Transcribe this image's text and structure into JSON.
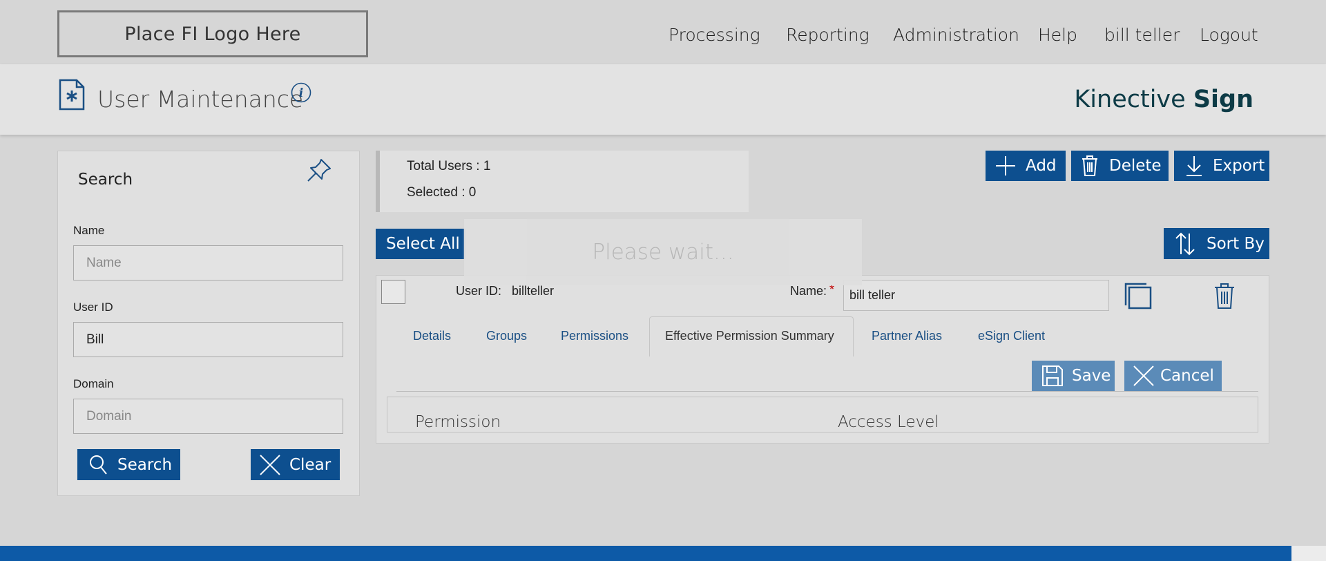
{
  "header": {
    "logo_text": "Place FI Logo Here",
    "nav": [
      "Processing",
      "Reporting",
      "Administration",
      "Help",
      "bill teller",
      "Logout"
    ]
  },
  "page": {
    "title": "User Maintenance",
    "brand_light": "Kinective",
    "brand_bold": "Sign"
  },
  "search": {
    "title": "Search",
    "name_label": "Name",
    "name_placeholder": "Name",
    "name_value": "",
    "userid_label": "User ID",
    "userid_value": "Bill",
    "domain_label": "Domain",
    "domain_placeholder": "Domain",
    "domain_value": "",
    "search_button": "Search",
    "clear_button": "Clear"
  },
  "summary": {
    "total_users": "Total Users : 1",
    "selected": "Selected : 0"
  },
  "toolbar": {
    "add": "Add",
    "delete": "Delete",
    "export": "Export",
    "select_all": "Select All",
    "sort_by": "Sort By"
  },
  "loading": "Please wait...",
  "user": {
    "userid_label": "User ID:",
    "userid_value": "billteller",
    "name_label": "Name:",
    "required_mark": "*",
    "name_value": "bill teller"
  },
  "tabs": [
    "Details",
    "Groups",
    "Permissions",
    "Effective Permission Summary",
    "Partner Alias",
    "eSign Client"
  ],
  "actions": {
    "save": "Save",
    "cancel": "Cancel"
  },
  "table": {
    "col_permission": "Permission",
    "col_access": "Access Level"
  },
  "colors": {
    "primary": "#0d4f8f",
    "footer": "#0d5aa7",
    "link": "#1a4f84",
    "brand": "#0d3b46",
    "required": "#c00000"
  }
}
